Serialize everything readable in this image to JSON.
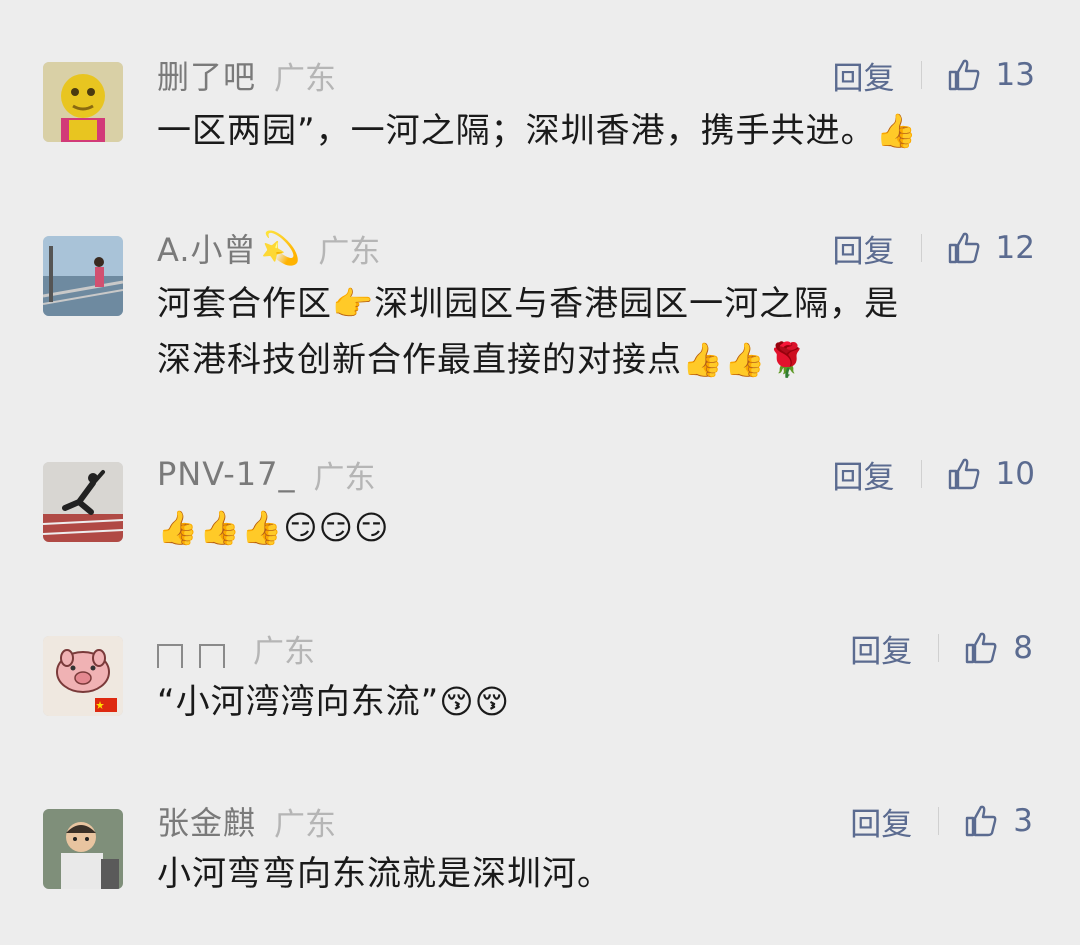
{
  "reply_label": "回复",
  "comments": [
    {
      "name": "删了吧",
      "region": "广东",
      "likes": "13",
      "text": "一区两园”，一河之隔；深圳香港，携手共进。",
      "trailing_emoji": "👍"
    },
    {
      "name": "A.小曾",
      "name_emoji": "💫",
      "region": "广东",
      "likes": "12",
      "text_line1": "河套合作区",
      "text_emoji1": "👉",
      "text_line1_rest": "深圳园区与香港园区一河之隔，是",
      "text_line2": "深港科技创新合作最直接的对接点",
      "trailing_emoji": "👍👍🌹"
    },
    {
      "name": "PNV-17_",
      "region": "广东",
      "likes": "10",
      "emojis": "👍👍👍😏😏😏"
    },
    {
      "name_boxes": 2,
      "region": "广东",
      "likes": "8",
      "text": "“小河湾湾向东流”",
      "trailing_emoji": "😚😚"
    },
    {
      "name": "张金麒",
      "region": "广东",
      "likes": "3",
      "text": "小河弯弯向东流就是深圳河。"
    }
  ]
}
